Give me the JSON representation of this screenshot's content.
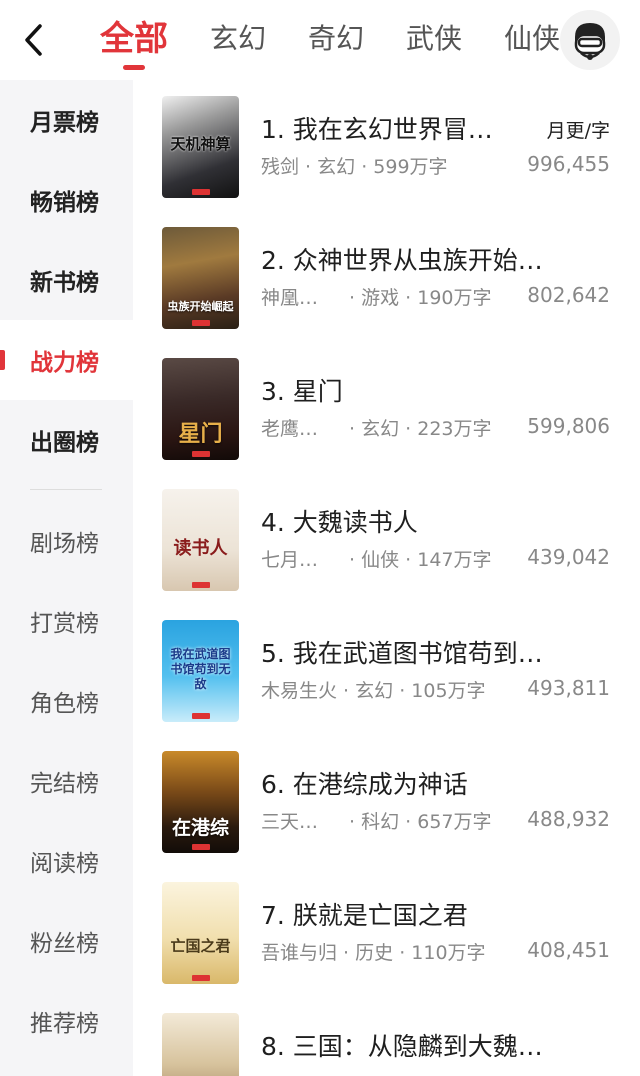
{
  "header": {
    "tabs": [
      {
        "label": "全部",
        "active": true
      },
      {
        "label": "玄幻"
      },
      {
        "label": "奇幻"
      },
      {
        "label": "武侠"
      },
      {
        "label": "仙侠"
      }
    ],
    "back_icon": "chevron-left-icon",
    "avatar_icon": "user-avatar-icon"
  },
  "sidebar": {
    "items": [
      {
        "label": "月票榜"
      },
      {
        "label": "畅销榜"
      },
      {
        "label": "新书榜"
      },
      {
        "label": "战力榜",
        "active": true
      },
      {
        "label": "出圈榜"
      },
      {
        "label": "剧场榜"
      },
      {
        "label": "打赏榜"
      },
      {
        "label": "角色榜"
      },
      {
        "label": "完结榜"
      },
      {
        "label": "阅读榜"
      },
      {
        "label": "粉丝榜"
      },
      {
        "label": "推荐榜"
      }
    ]
  },
  "list": {
    "unit_label": "月更/字",
    "items": [
      {
        "title": "1. 我在玄幻世界冒…",
        "author": "残剑",
        "genre": "玄幻",
        "words": "599万字",
        "value": "996,455",
        "cover_text": "天机神算"
      },
      {
        "title": "2. 众神世界从虫族开始…",
        "author": "神凰…",
        "genre": "游戏",
        "words": "190万字",
        "value": "802,642",
        "cover_text": "虫族开始崛起"
      },
      {
        "title": "3. 星门",
        "author": "老鹰…",
        "genre": "玄幻",
        "words": "223万字",
        "value": "599,806",
        "cover_text": "星门"
      },
      {
        "title": "4. 大魏读书人",
        "author": "七月…",
        "genre": "仙侠",
        "words": "147万字",
        "value": "439,042",
        "cover_text": "读书人"
      },
      {
        "title": "5. 我在武道图书馆苟到…",
        "author": "木易生火",
        "genre": "玄幻",
        "words": "105万字",
        "value": "493,811",
        "cover_text": "我在武道图书馆苟到无敌"
      },
      {
        "title": "6. 在港综成为神话",
        "author": "三天…",
        "genre": "科幻",
        "words": "657万字",
        "value": "488,932",
        "cover_text": "在港综"
      },
      {
        "title": "7. 朕就是亡国之君",
        "author": "吾谁与归",
        "genre": "历史",
        "words": "110万字",
        "value": "408,451",
        "cover_text": "亡国之君"
      },
      {
        "title": "8. 三国：从隐麟到大魏…",
        "author": "",
        "genre": "",
        "words": "",
        "value": "",
        "cover_text": ""
      }
    ]
  },
  "colors": {
    "accent": "#e1353a",
    "sidebar_bg": "#f5f5f7",
    "meta_text": "#888888"
  }
}
